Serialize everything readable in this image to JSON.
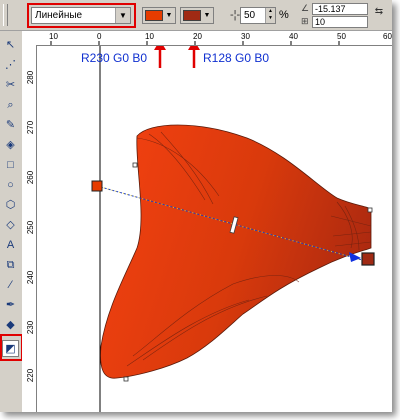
{
  "toolbar": {
    "fill_type": "Линейные",
    "start_color": "#e63c00",
    "end_color": "#a02a14",
    "midpoint_value": "50",
    "percent_sign": "%",
    "angle_value": "-15.137",
    "edge_pad_value": "10"
  },
  "annotations": {
    "start_label": "R230 G0 B0",
    "end_label": "R128 G0 B0"
  },
  "rulers": {
    "h_labels": [
      "10",
      "0",
      "10",
      "20",
      "30",
      "40",
      "50",
      "60"
    ],
    "v_labels": [
      "280",
      "270",
      "260",
      "250",
      "240",
      "230",
      "220"
    ]
  },
  "tools": [
    "pick-tool",
    "shape-tool",
    "crop-tool",
    "zoom-tool",
    "freehand-tool",
    "smart-fill-tool",
    "rectangle-tool",
    "ellipse-tool",
    "polygon-tool",
    "basic-shapes-tool",
    "text-tool",
    "interactive-blend-tool",
    "eyedropper-tool",
    "outline-tool",
    "fill-tool",
    "interactive-fill-tool"
  ],
  "colors": {
    "highlight": "#e00000",
    "annotation_text": "#1030d0",
    "shape_light": "#f04010",
    "shape_dark": "#a82810"
  }
}
